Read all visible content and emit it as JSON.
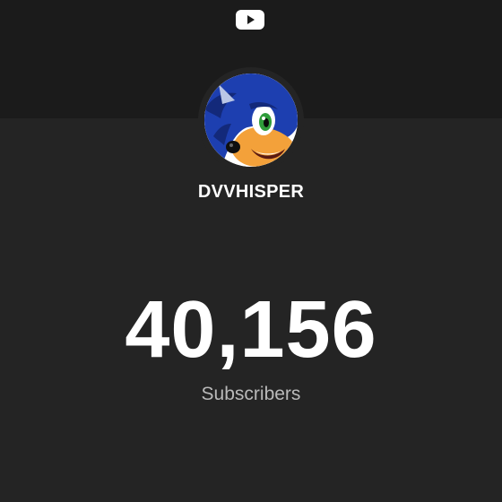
{
  "header": {
    "logo_icon": "youtube-play-icon",
    "logo_color": "#ffffff",
    "band_color": "#1b1b1b"
  },
  "channel": {
    "avatar_icon": "sonic-hedgehog-avatar",
    "name": "DVVHISPER"
  },
  "stats": {
    "subscriber_count": "40,156",
    "subscriber_label": "Subscribers"
  },
  "colors": {
    "background": "#242424",
    "text_primary": "#ffffff",
    "text_secondary": "#b9b9b9"
  }
}
